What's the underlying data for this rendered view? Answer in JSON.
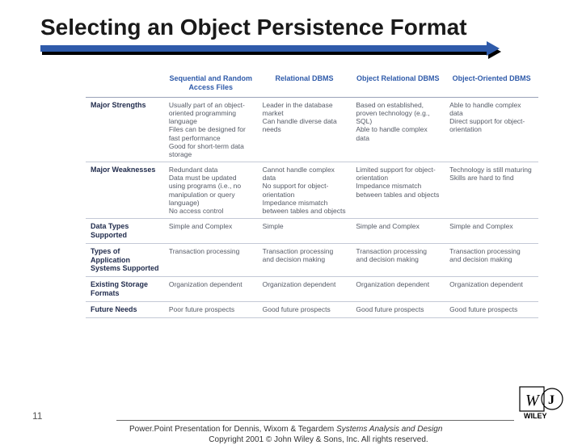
{
  "title": "Selecting an Object Persistence Format",
  "columns": [
    "",
    "Sequential and Random Access Files",
    "Relational DBMS",
    "Object Relational DBMS",
    "Object-Oriented DBMS"
  ],
  "rows": [
    {
      "head": "Major Strengths",
      "cells": [
        [
          "Usually part of an object-oriented programming language",
          "Files can be designed for fast performance",
          "Good for short-term data storage"
        ],
        [
          "Leader in the database market",
          "Can handle diverse data needs"
        ],
        [
          "Based on established, proven technology (e.g., SQL)",
          "Able to handle complex data"
        ],
        [
          "Able to handle complex data",
          "Direct support for object-orientation"
        ]
      ]
    },
    {
      "head": "Major Weaknesses",
      "cells": [
        [
          "Redundant data",
          "Data must be updated using programs (i.e., no manipulation or query language)",
          "No access control"
        ],
        [
          "Cannot handle complex data",
          "No support for object-orientation",
          "Impedance mismatch between tables and objects"
        ],
        [
          "Limited support for object-orientation",
          "Impedance mismatch between tables and objects"
        ],
        [
          "Technology is still maturing",
          "Skills are hard to find"
        ]
      ]
    },
    {
      "head": "Data Types Supported",
      "cells": [
        [
          "Simple and Complex"
        ],
        [
          "Simple"
        ],
        [
          "Simple and Complex"
        ],
        [
          "Simple and Complex"
        ]
      ]
    },
    {
      "head": "Types of Application Systems Supported",
      "cells": [
        [
          "Transaction processing"
        ],
        [
          "Transaction processing and decision making"
        ],
        [
          "Transaction processing and decision making"
        ],
        [
          "Transaction processing and decision making"
        ]
      ]
    },
    {
      "head": "Existing Storage Formats",
      "cells": [
        [
          "Organization dependent"
        ],
        [
          "Organization dependent"
        ],
        [
          "Organization dependent"
        ],
        [
          "Organization dependent"
        ]
      ]
    },
    {
      "head": "Future Needs",
      "cells": [
        [
          "Poor future prospects"
        ],
        [
          "Good future prospects"
        ],
        [
          "Good future prospects"
        ],
        [
          "Good future prospects"
        ]
      ]
    }
  ],
  "footer": {
    "slide_number": "11",
    "line1_prefix": "Power.Point Presentation for Dennis, Wixom & Tegardem    ",
    "line1_em": "Systems Analysis and Design",
    "line2": "Copyright 2001 © John Wiley & Sons, Inc.  All rights reserved."
  },
  "logo": {
    "brand": "WILEY"
  }
}
